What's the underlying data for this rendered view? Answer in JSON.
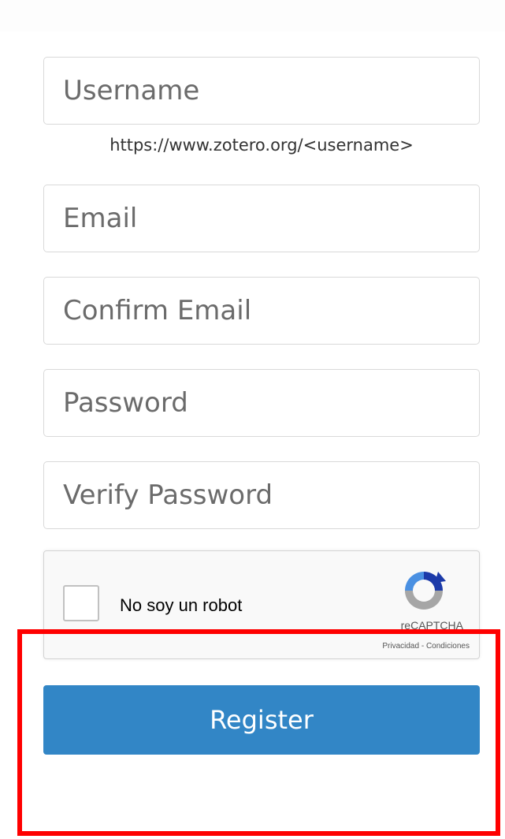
{
  "form": {
    "username": {
      "placeholder": "Username",
      "value": ""
    },
    "username_hint": "https://www.zotero.org/<username>",
    "email": {
      "placeholder": "Email",
      "value": ""
    },
    "confirm_email": {
      "placeholder": "Confirm Email",
      "value": ""
    },
    "password": {
      "placeholder": "Password",
      "value": ""
    },
    "verify_password": {
      "placeholder": "Verify Password",
      "value": ""
    },
    "register_label": "Register"
  },
  "captcha": {
    "checkbox_label": "No soy un robot",
    "brand": "reCAPTCHA",
    "privacy_link": "Privacidad",
    "separator": " - ",
    "terms_link": "Condiciones",
    "logo_icon": "recaptcha-logo-icon",
    "checked": false
  },
  "colors": {
    "register_button": "#3286c6",
    "highlight_border": "#ff0000"
  }
}
